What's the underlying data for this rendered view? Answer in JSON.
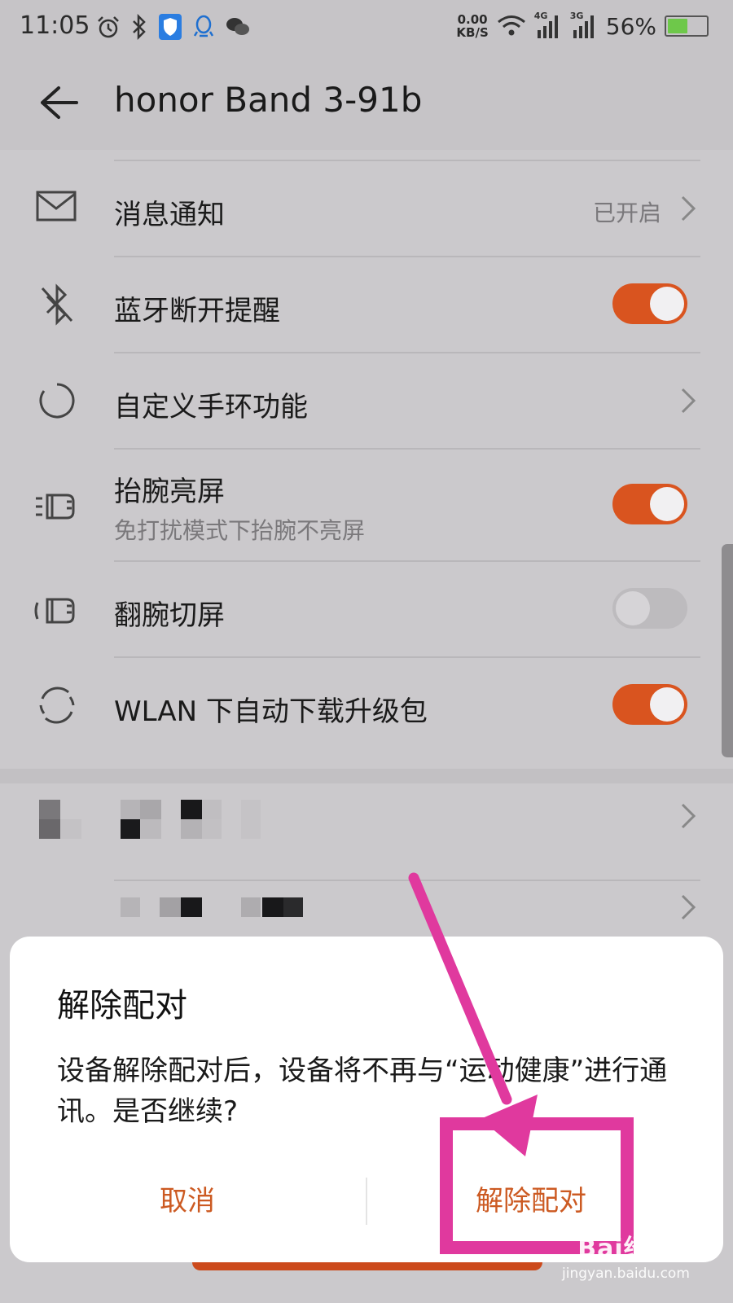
{
  "status_bar": {
    "time": "11:05",
    "speed_value": "0.00",
    "speed_unit": "KB/S",
    "net1": "4G",
    "net2": "3G",
    "battery": "56%",
    "battery_level": 0.56,
    "icons": [
      "alarm-icon",
      "bluetooth-icon",
      "shield-icon",
      "qq-icon",
      "wechat-icon",
      "wifi-icon",
      "signal-icon",
      "battery-icon"
    ]
  },
  "header": {
    "title": "honor Band 3-91b"
  },
  "settings": [
    {
      "icon": "mail-icon",
      "label": "消息通知",
      "value": "已开启",
      "control": "chevron"
    },
    {
      "icon": "bluetooth-off-icon",
      "label": "蓝牙断开提醒",
      "control": "toggle",
      "on": true
    },
    {
      "icon": "circle-refresh-icon",
      "label": "自定义手环功能",
      "control": "chevron"
    },
    {
      "icon": "raise-wrist-icon",
      "label": "抬腕亮屏",
      "sublabel": "免打扰模式下抬腕不亮屏",
      "control": "toggle",
      "on": true
    },
    {
      "icon": "rotate-wrist-icon",
      "label": "翻腕切屏",
      "control": "toggle",
      "on": false
    },
    {
      "icon": "sync-icon",
      "label": "WLAN 下自动下载升级包",
      "control": "toggle",
      "on": true
    }
  ],
  "dialog": {
    "title": "解除配对",
    "message": "设备解除配对后，设备将不再与“运动健康”进行通讯。是否继续?",
    "cancel": "取消",
    "confirm": "解除配对"
  },
  "colors": {
    "accent": "#d9541f",
    "dialog_button": "#cc5a22",
    "annotation": "#e0399e",
    "background": "#cbc9cc"
  },
  "watermark": {
    "logo": "Bai经验",
    "url": "jingyan.baidu.com"
  }
}
